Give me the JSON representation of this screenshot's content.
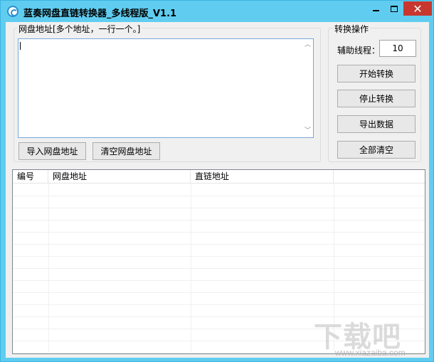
{
  "window": {
    "title": "蓝奏网盘直链转换器_多线程版_V1.1",
    "icon": "app-icon",
    "controls": {
      "minimize": "minimize-icon",
      "maximize": "maximize-icon",
      "close": "✕"
    }
  },
  "url_panel": {
    "legend": "网盘地址[多个地址，一行一个。]",
    "textarea_value": "",
    "import_button": "导入网盘地址",
    "clear_button": "清空网盘地址"
  },
  "operations": {
    "legend": "转换操作",
    "thread_label": "辅助线程：",
    "thread_value": "10",
    "start_button": "开始转换",
    "stop_button": "停止转换",
    "export_button": "导出数据",
    "clear_all_button": "全部清空"
  },
  "table": {
    "columns": [
      "编号",
      "网盘地址",
      "直链地址",
      ""
    ],
    "rows": []
  },
  "watermark": {
    "text": "下载吧",
    "url": "www.xiazaiba.com"
  }
}
